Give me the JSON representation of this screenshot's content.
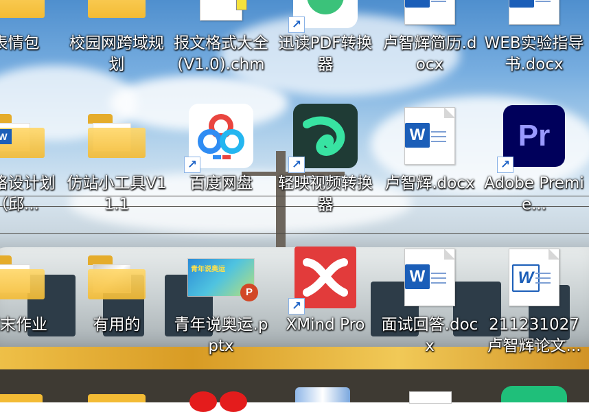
{
  "desktop": {
    "icons": [
      {
        "label": "表情包"
      },
      {
        "label": "校园网跨域规划"
      },
      {
        "label": "报文格式大全(V1.0).chm"
      },
      {
        "label": "迅读PDF转换器"
      },
      {
        "label": "卢智辉简历.docx"
      },
      {
        "label": "WEB实验指导书.docx"
      },
      {
        "label": "网络设计划（邱..."
      },
      {
        "label": "仿站小工具V11.1"
      },
      {
        "label": "百度网盘"
      },
      {
        "label": "轻映视频转换器"
      },
      {
        "label": "卢智辉.docx"
      },
      {
        "label": "Adobe Premie..."
      },
      {
        "label": "期末作业"
      },
      {
        "label": "有用的"
      },
      {
        "label": "青年说奥运.pptx"
      },
      {
        "label": "XMind Pro"
      },
      {
        "label": "面试回答.docx"
      },
      {
        "label": "211231027卢智辉论文..."
      }
    ],
    "ppt_thumb_text": "青年说奥运",
    "word_letter": "W",
    "pr_letter": "Pr"
  },
  "colors": {
    "word_blue": "#1b5eb8",
    "folder_yellow": "#f3bb35",
    "pr_purple": "#00005b",
    "xmind_red": "#e23b3b"
  }
}
